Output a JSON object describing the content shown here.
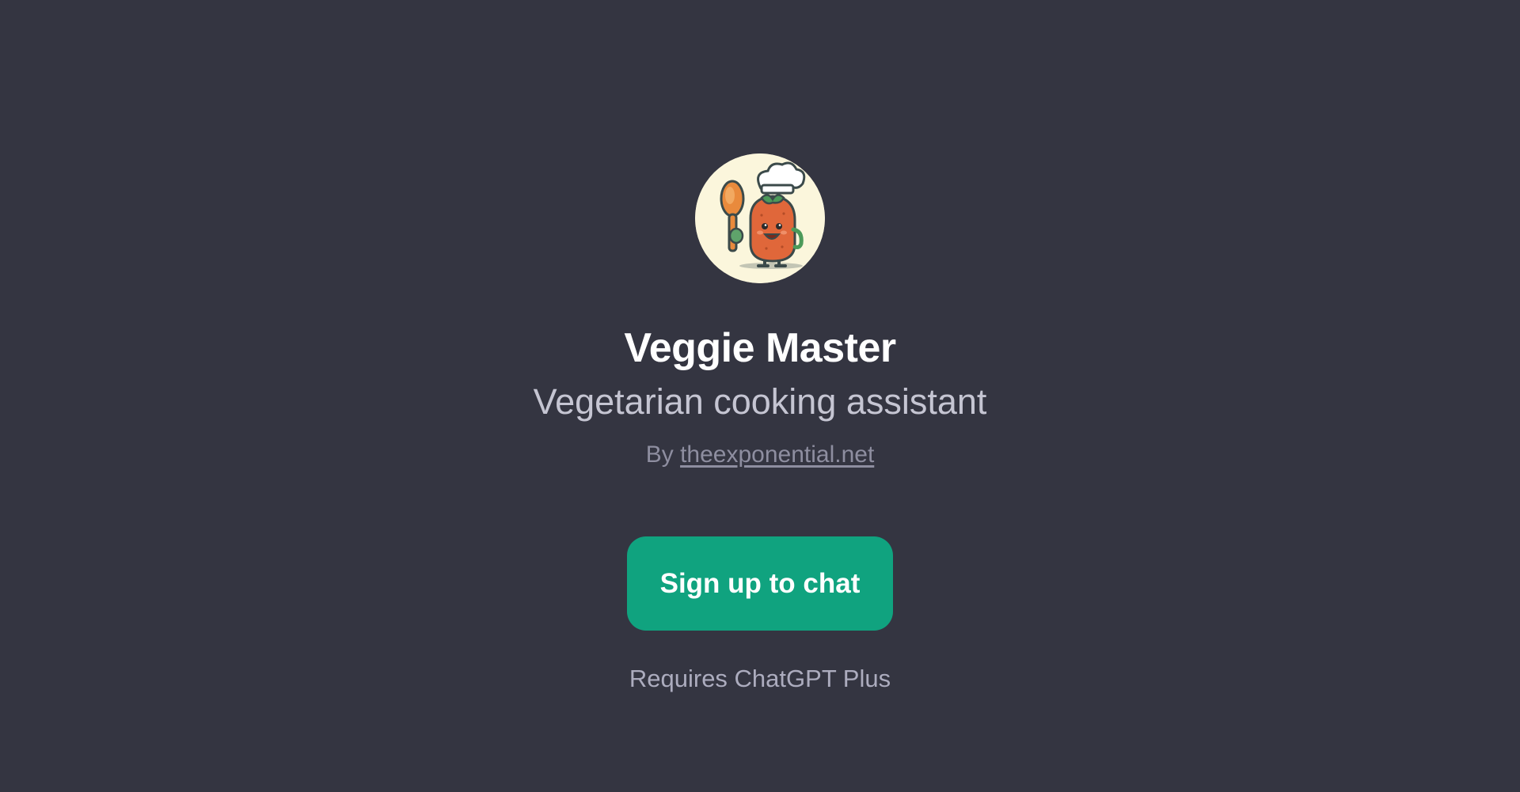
{
  "gpt": {
    "name": "Veggie Master",
    "description": "Vegetarian cooking assistant",
    "byline_prefix": "By",
    "author_link": "theexponential.net",
    "avatar_icon": "chef-vegetable-avatar-icon"
  },
  "cta": {
    "signup_label": "Sign up to chat",
    "requirement_note": "Requires ChatGPT Plus"
  },
  "colors": {
    "background": "#343541",
    "accent": "#10a37f",
    "title": "#ffffff",
    "subtitle": "#c5c5d2",
    "muted": "#8e8ea0"
  }
}
